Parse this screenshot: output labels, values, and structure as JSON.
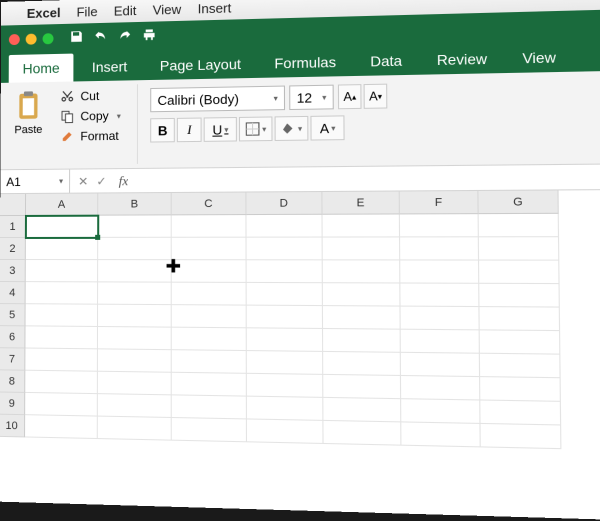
{
  "menubar": {
    "app": "Excel",
    "items": [
      "File",
      "Edit",
      "View",
      "Insert"
    ]
  },
  "ribbon_tabs": [
    "Home",
    "Insert",
    "Page Layout",
    "Formulas",
    "Data",
    "Review",
    "View"
  ],
  "active_tab": "Home",
  "clipboard": {
    "paste": "Paste",
    "cut": "Cut",
    "copy": "Copy",
    "format": "Format"
  },
  "font": {
    "name": "Calibri (Body)",
    "size": "12",
    "bold": "B",
    "italic": "I",
    "underline": "U"
  },
  "namebox": "A1",
  "fx_label": "fx",
  "columns": [
    "A",
    "B",
    "C",
    "D",
    "E",
    "F",
    "G"
  ],
  "rows": [
    "1",
    "2",
    "3",
    "4",
    "5",
    "6",
    "7",
    "8",
    "9",
    "10"
  ],
  "colors": {
    "brand": "#1a6b3d",
    "fill": "#ffd966",
    "font_color": "#c00000"
  }
}
